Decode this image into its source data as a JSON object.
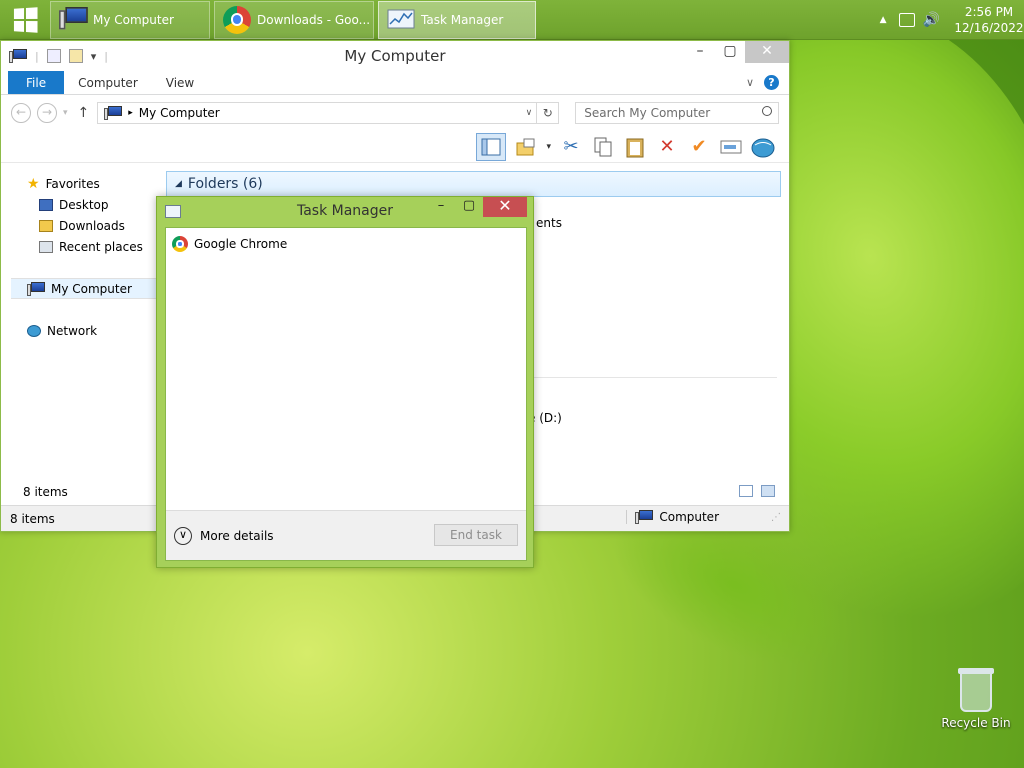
{
  "taskbar": {
    "buttons": [
      {
        "label": "My Computer",
        "icon": "my-computer-icon"
      },
      {
        "label": "Downloads - Goo...",
        "icon": "chrome-icon"
      },
      {
        "label": "Task Manager",
        "icon": "task-manager-icon"
      }
    ],
    "clock_time": "2:56 PM",
    "clock_date": "12/16/2022"
  },
  "explorer": {
    "title": "My Computer",
    "ribbon_tabs": [
      "File",
      "Computer",
      "View"
    ],
    "address": "My Computer",
    "search_placeholder": "Search My Computer",
    "sidebar": {
      "favorites": "Favorites",
      "desktop": "Desktop",
      "downloads": "Downloads",
      "recent": "Recent places",
      "my_computer": "My Computer",
      "network": "Network"
    },
    "folders_header": "Folders (6)",
    "peek_text_1": "ents",
    "peek_text_2": "e (D:)",
    "items_count": "8 items",
    "status_items": "8 items",
    "status_location": "Computer"
  },
  "task_manager": {
    "title": "Task Manager",
    "apps": [
      "Google Chrome"
    ],
    "more_details": "More details",
    "end_task": "End task"
  },
  "desktop": {
    "recycle_bin": "Recycle Bin"
  },
  "colors": {
    "accent_blue": "#1979ca",
    "taskbar_green": "#7fb33a",
    "close_red": "#c74f52"
  }
}
